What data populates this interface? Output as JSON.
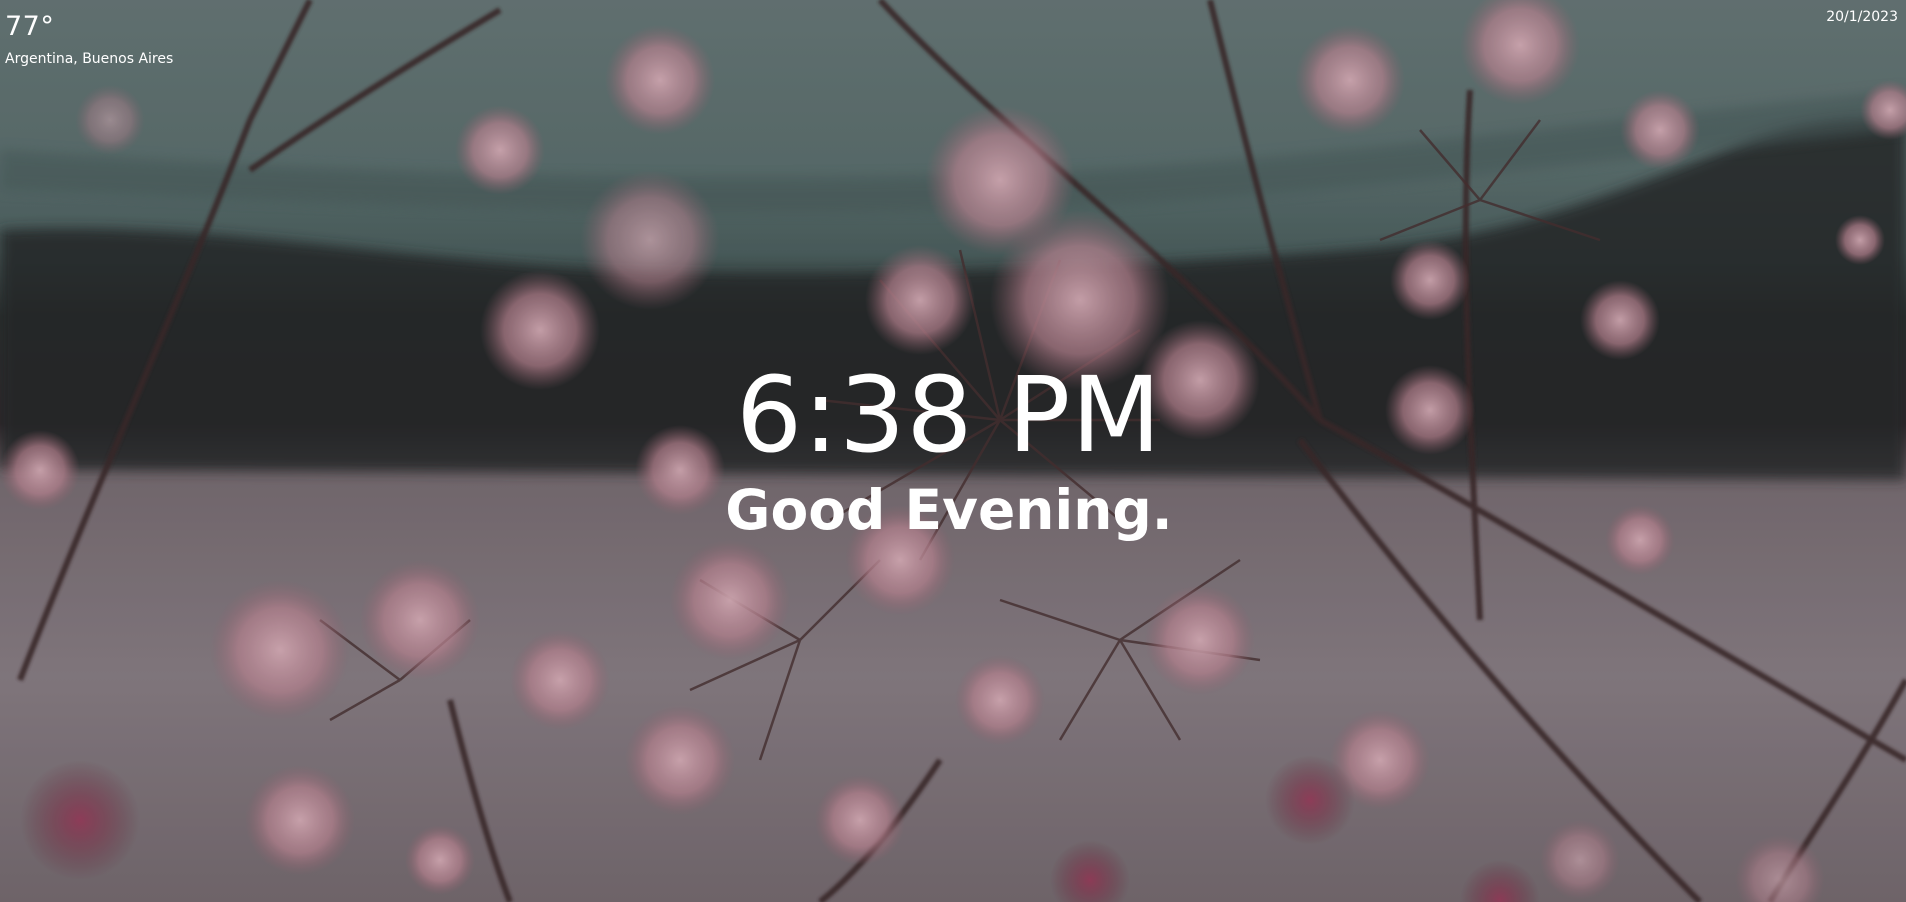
{
  "weather": {
    "temperature": "77°",
    "location": "Argentina, Buenos Aires"
  },
  "date": "20/1/2023",
  "clock": {
    "time": "6:38 PM",
    "greeting": "Good Evening."
  },
  "background": {
    "sky_color": "#5f7573",
    "hills_color": "#2a2e2c",
    "snow_color": "#8c8388",
    "blossom_color": "#c98f9d",
    "stem_color": "#4a2a2c"
  }
}
